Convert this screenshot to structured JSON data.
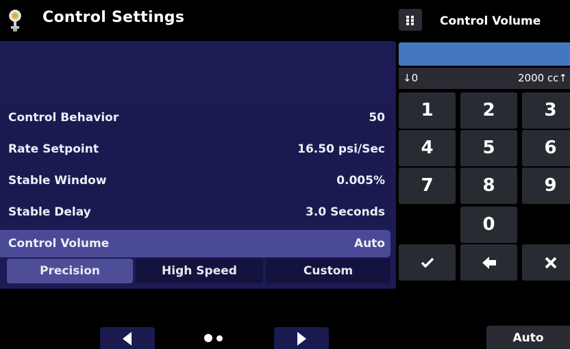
{
  "header": {
    "title": "Control Settings",
    "icon": "pressure-gauge-icon"
  },
  "settings": [
    {
      "label": "Control Behavior",
      "value": "50",
      "selected": false
    },
    {
      "label": "Rate Setpoint",
      "value": "16.50 psi/Sec",
      "selected": false
    },
    {
      "label": "Stable Window",
      "value": "0.005%",
      "selected": false
    },
    {
      "label": "Stable Delay",
      "value": "3.0 Seconds",
      "selected": false
    },
    {
      "label": "Control Volume",
      "value": "Auto",
      "selected": true
    }
  ],
  "modes": [
    {
      "label": "Precision",
      "active": true
    },
    {
      "label": "High Speed",
      "active": false
    },
    {
      "label": "Custom",
      "active": false
    }
  ],
  "pager": {
    "pages": 2,
    "current": 1
  },
  "keypad": {
    "title": "Control Volume",
    "bar_fill": 1.0,
    "range_min": "↓0",
    "range_max": "2000 cc↑",
    "keys": [
      "1",
      "2",
      "3",
      "4",
      "5",
      "6",
      "7",
      "8",
      "9",
      "0"
    ],
    "action_icons": [
      "checkmark-icon",
      "backspace-arrow-icon",
      "close-icon"
    ],
    "auto_label": "Auto"
  },
  "colors": {
    "panel_bg": "#1c1b54",
    "selected_row": "#4a4a96",
    "active_mode": "#4e4e98",
    "key_bg": "#292b33",
    "bar_blue": "#4378c0"
  }
}
